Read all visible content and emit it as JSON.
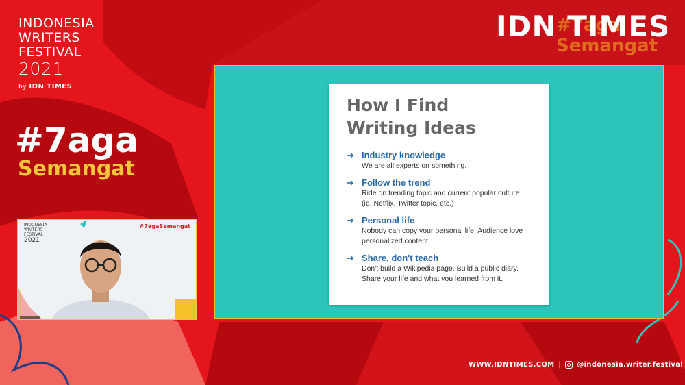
{
  "festival": {
    "line1": "INDONESIA",
    "line2": "WRITERS",
    "line3": "FESTIVAL",
    "year": "2021",
    "by": "by",
    "by_brand": "IDN TIMES"
  },
  "logo": {
    "main": "IDN TIMES",
    "ghost": "#7aga Semangat"
  },
  "hashtag": {
    "line1": "#7aga",
    "line2": "Semangat"
  },
  "slide": {
    "title_line1": "How I Find",
    "title_line2": "Writing Ideas",
    "arrow": "➜",
    "points": [
      {
        "head": "Industry knowledge",
        "desc": "We are all experts on something."
      },
      {
        "head": "Follow the trend",
        "desc": "Ride on trending topic and current popular culture (ie. Netflix, Twitter topic, etc.)"
      },
      {
        "head": "Personal life",
        "desc": "Nobody can copy your personal life. Audience love personalized content."
      },
      {
        "head": "Share, don't teach",
        "desc": "Don't build a Wikipedia page. Build a public diary. Share your life and what you learned from it."
      }
    ]
  },
  "webcam": {
    "mini_line1": "INDONESIA",
    "mini_line2": "WRITERS",
    "mini_line3": "FESTIVAL",
    "mini_year": "2021",
    "tag": "#7agaSemangat"
  },
  "footer": {
    "website": "WWW.IDNTIMES.COM",
    "separator": "|",
    "instagram": "@indonesia.writer.festival"
  },
  "colors": {
    "background_red": "#e4161b",
    "dark_red": "#b5090f",
    "teal": "#2cc5bd",
    "gold": "#f5c63a",
    "blue_text": "#2b6aa8"
  }
}
